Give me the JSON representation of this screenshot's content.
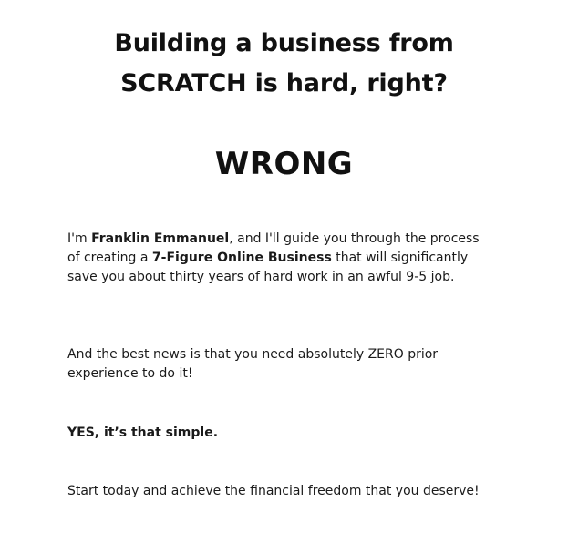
{
  "headline": {
    "line1": "Building a business from",
    "line2": "SCRATCH is hard, right?"
  },
  "emphasis": "WRONG",
  "intro": {
    "prefix": "I'm ",
    "name": "Franklin Emmanuel",
    "middle": ", and I'll guide you through the process of creating a ",
    "highlight": "7-Figure Online Business",
    "suffix": " that will significantly save you about thirty years of hard work in an awful 9-5 job."
  },
  "news_paragraph": "And the best news is that you need absolutely ZERO prior experience to do it!",
  "simple_paragraph": "YES, it’s that simple.",
  "closing_paragraph": "Start today and achieve the financial freedom that you deserve!"
}
